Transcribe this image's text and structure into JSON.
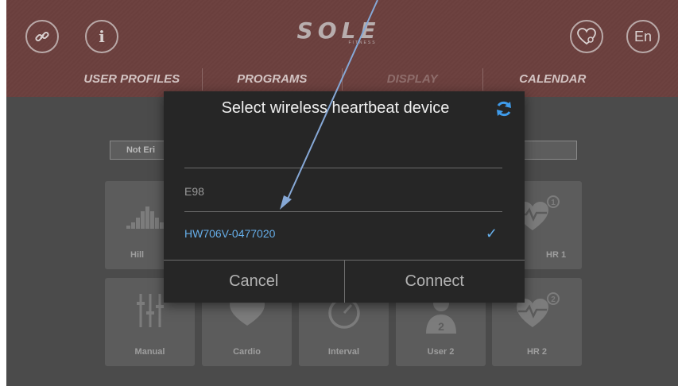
{
  "header": {
    "logo_text": "SOLE",
    "logo_sub": "FITNESS",
    "info_glyph": "i",
    "lang_label": "En",
    "icons": {
      "left": "link-icon",
      "info": "info-icon",
      "heart": "heart-connect-icon"
    }
  },
  "tabs": [
    {
      "label": "USER PROFILES"
    },
    {
      "label": "PROGRAMS"
    },
    {
      "label": "DISPLAY"
    },
    {
      "label": "CALENDAR"
    }
  ],
  "background": {
    "pill_left": "Not Eri",
    "tiles": [
      "Hill",
      "HR 1",
      "Manual",
      "Cardio",
      "Interval",
      "User 2",
      "HR 2"
    ],
    "badges": {
      "hr1": "1",
      "user2": "2",
      "hr2": "2"
    }
  },
  "dialog": {
    "title": "Select wireless heartbeat device",
    "devices": [
      {
        "name": "E98",
        "selected": false
      },
      {
        "name": "HW706V-0477020",
        "selected": true
      }
    ],
    "check_glyph": "✓",
    "cancel_label": "Cancel",
    "connect_label": "Connect"
  },
  "colors": {
    "header_bg": "#6d4240",
    "dialog_bg": "#262626",
    "accent_blue": "#66aee9",
    "screen_bg": "#4b4b4b"
  }
}
